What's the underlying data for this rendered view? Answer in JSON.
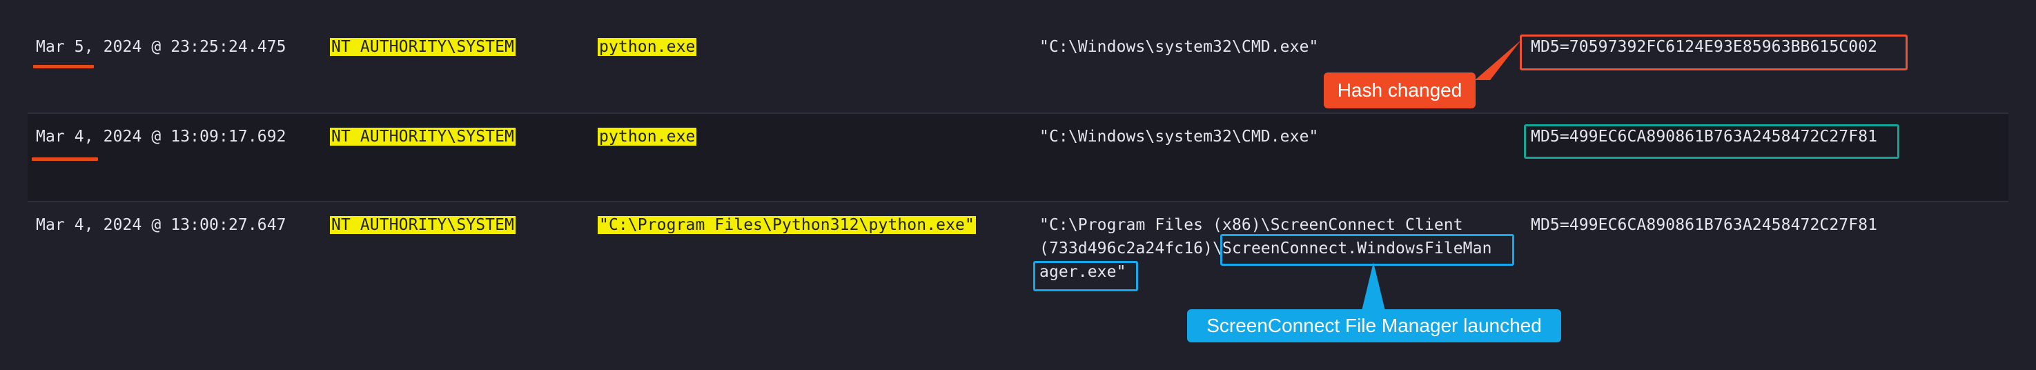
{
  "events": [
    {
      "timestamp": "Mar 5, 2024 @ 23:25:24.475",
      "user": "NT AUTHORITY\\SYSTEM",
      "process": "python.exe",
      "command_line": "\"C:\\Windows\\system32\\CMD.exe\"",
      "hash": "MD5=70597392FC6124E93E85963BB615C002"
    },
    {
      "timestamp": "Mar 4, 2024 @ 13:09:17.692",
      "user": "NT AUTHORITY\\SYSTEM",
      "process": "python.exe",
      "command_line": "\"C:\\Windows\\system32\\CMD.exe\"",
      "hash": "MD5=499EC6CA890861B763A2458472C27F81"
    },
    {
      "timestamp": "Mar 4, 2024 @ 13:00:27.647",
      "user": "NT AUTHORITY\\SYSTEM",
      "process": "\"C:\\Program Files\\Python312\\python.exe\"",
      "command_line_lines": [
        "\"C:\\Program Files (x86)\\ScreenConnect Client",
        "(733d496c2a24fc16)\\ScreenConnect.WindowsFileMan",
        "ager.exe\""
      ],
      "hash": "MD5=499EC6CA890861B763A2458472C27F81"
    }
  ],
  "annotations": {
    "hash_changed": "Hash changed",
    "screenconnect_launched": "ScreenConnect File Manager launched"
  },
  "colors": {
    "background": "#1f2029",
    "highlight": "#f4ef00",
    "red": "#ee5133",
    "teal": "#13a597",
    "blue": "#13a9ec"
  }
}
